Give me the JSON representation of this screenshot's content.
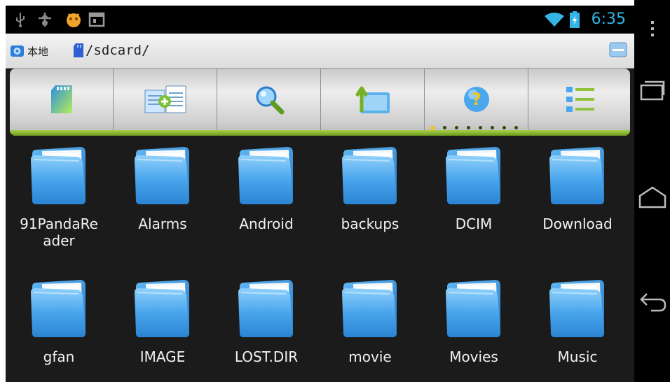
{
  "status_bar": {
    "time": "6:35",
    "icons": [
      "usb-icon",
      "usb-debug-icon",
      "notification-app-icon",
      "screenshot-icon",
      "wifi-icon",
      "battery-icon"
    ]
  },
  "path_bar": {
    "local_label": "本地",
    "path": "/sdcard/"
  },
  "toolbar": {
    "buttons": [
      {
        "icon": "sdcard-icon"
      },
      {
        "icon": "copy-files-icon"
      },
      {
        "icon": "search-icon"
      },
      {
        "icon": "up-folder-icon"
      },
      {
        "icon": "help-icon"
      },
      {
        "icon": "list-view-icon"
      }
    ],
    "page_dots": 7,
    "active_page": 0
  },
  "files": [
    {
      "name": "91PandaRe\nader"
    },
    {
      "name": "Alarms"
    },
    {
      "name": "Android"
    },
    {
      "name": "backups"
    },
    {
      "name": "DCIM"
    },
    {
      "name": "Download"
    },
    {
      "name": "gfan"
    },
    {
      "name": "IMAGE"
    },
    {
      "name": "LOST.DIR"
    },
    {
      "name": "movie"
    },
    {
      "name": "Movies"
    },
    {
      "name": "Music"
    }
  ],
  "nav_bar": {
    "buttons": [
      "menu-icon",
      "recent-apps-icon",
      "home-icon",
      "back-icon"
    ]
  },
  "colors": {
    "clock": "#33b5e5",
    "toolbar_accent": "#8cbf2f",
    "folder": "#4aa3e6"
  }
}
